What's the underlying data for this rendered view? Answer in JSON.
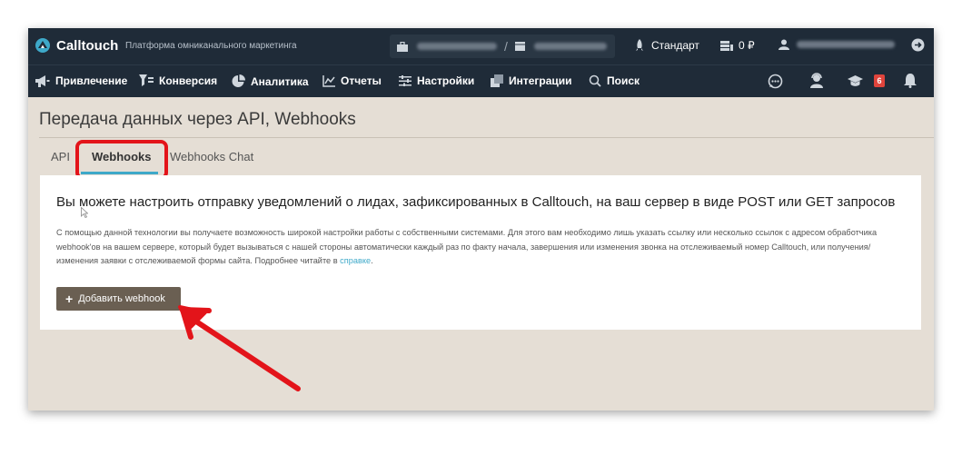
{
  "header": {
    "logo_text": "Calltouch",
    "tagline": "Платформа омниканального маркетинга",
    "plan_label": "Стандарт",
    "balance": "0 ₽"
  },
  "nav": {
    "items": [
      {
        "label": "Привлечение",
        "icon": "megaphone-icon"
      },
      {
        "label": "Конверсия",
        "icon": "funnel-icon"
      },
      {
        "label": "Аналитика",
        "icon": "pie-chart-icon"
      },
      {
        "label": "Отчеты",
        "icon": "line-chart-icon"
      },
      {
        "label": "Настройки",
        "icon": "sliders-icon"
      },
      {
        "label": "Интеграции",
        "icon": "puzzle-icon"
      },
      {
        "label": "Поиск",
        "icon": "search-icon"
      }
    ],
    "notifications_count": "6"
  },
  "page": {
    "title": "Передача данных через API, Webhooks",
    "tabs": [
      {
        "label": "API",
        "active": false
      },
      {
        "label": "Webhooks",
        "active": true
      },
      {
        "label": "Webhooks Chat",
        "active": false
      }
    ]
  },
  "panel": {
    "heading": "Вы можете настроить отправку уведомлений о лидах, зафиксированных в Calltouch, на ваш сервер в виде POST или GET запросов",
    "description": "С помощью данной технологии вы получаете возможность широкой настройки работы с собственными системами. Для этого вам необходимо лишь указать ссылку или несколько ссылок с адресом обработчика webhook'ов на вашем сервере, который будет вызываться с нашей стороны автоматически каждый раз по факту начала, завершения или изменения звонка на отслеживаемый номер Calltouch, или получения/изменения заявки с отслеживаемой формы сайта. Подробнее читайте в",
    "link_text": "справке",
    "link_suffix": ".",
    "add_button_label": "Добавить webhook"
  },
  "colors": {
    "header_bg": "#1f2b38",
    "page_bg": "#e5ded5",
    "accent": "#3ea9c9",
    "button_bg": "#6a5f52",
    "highlight": "#e3141a"
  }
}
